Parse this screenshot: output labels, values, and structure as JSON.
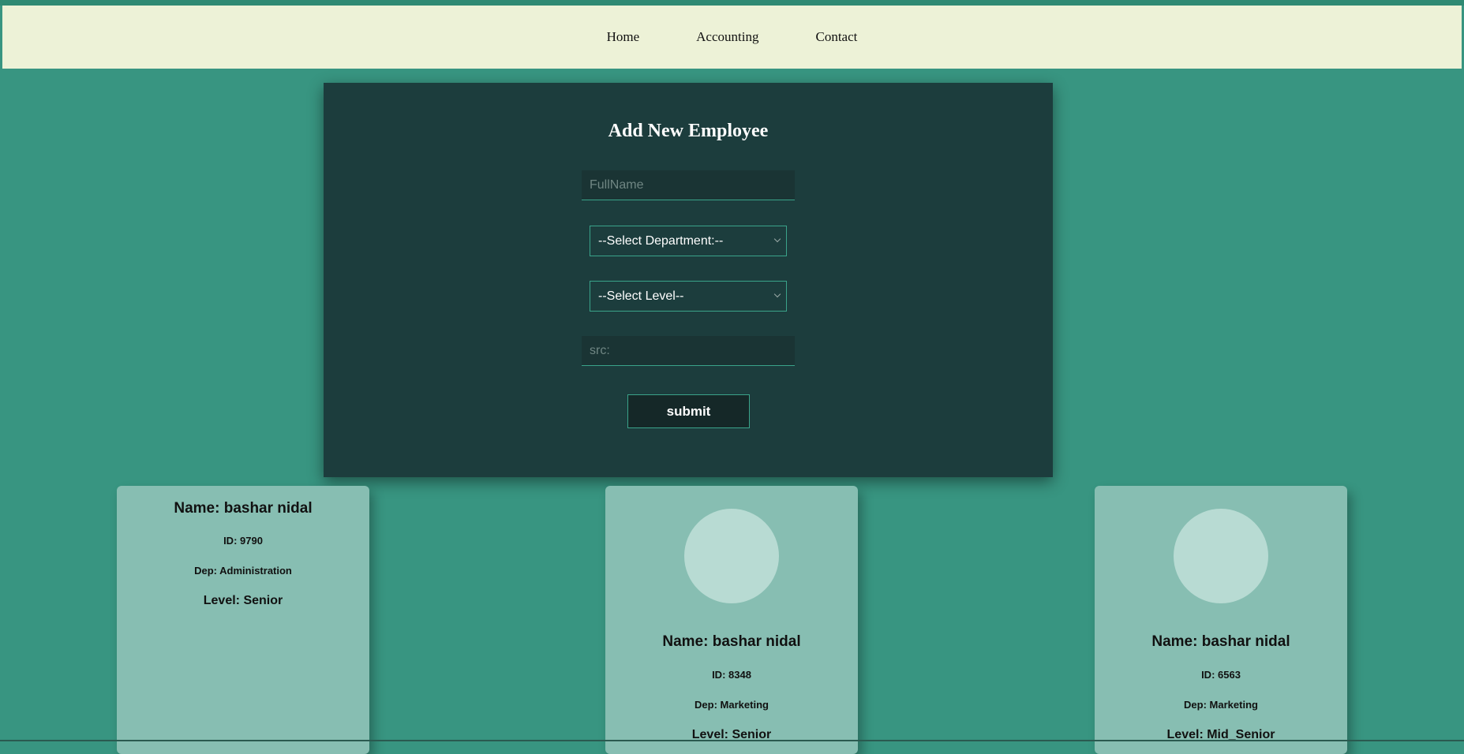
{
  "nav": {
    "items": [
      "Home",
      "Accounting",
      "Contact"
    ]
  },
  "form": {
    "title": "Add New Employee",
    "fullname_placeholder": "FullName",
    "department_selected": "--Select Department:--",
    "level_selected": "--Select Level--",
    "src_placeholder": "src:",
    "submit_label": "submit"
  },
  "cards": [
    {
      "name": "Name: bashar nidal",
      "id": "ID: 9790",
      "dep": "Dep: Administration",
      "level": "Level: Senior"
    },
    {
      "name": "Name: bashar nidal",
      "id": "ID: 8348",
      "dep": "Dep: Marketing",
      "level": "Level: Senior"
    },
    {
      "name": "Name: bashar nidal",
      "id": "ID: 6563",
      "dep": "Dep: Marketing",
      "level": "Level: Mid_Senior"
    }
  ],
  "colors": {
    "page_background": "#389581",
    "navbar_background": "#edf2d7",
    "panel_background": "#1c3d3d",
    "accent_border": "#3aa38a",
    "card_background": "#87beb2",
    "avatar_placeholder": "#b8dbd3"
  }
}
